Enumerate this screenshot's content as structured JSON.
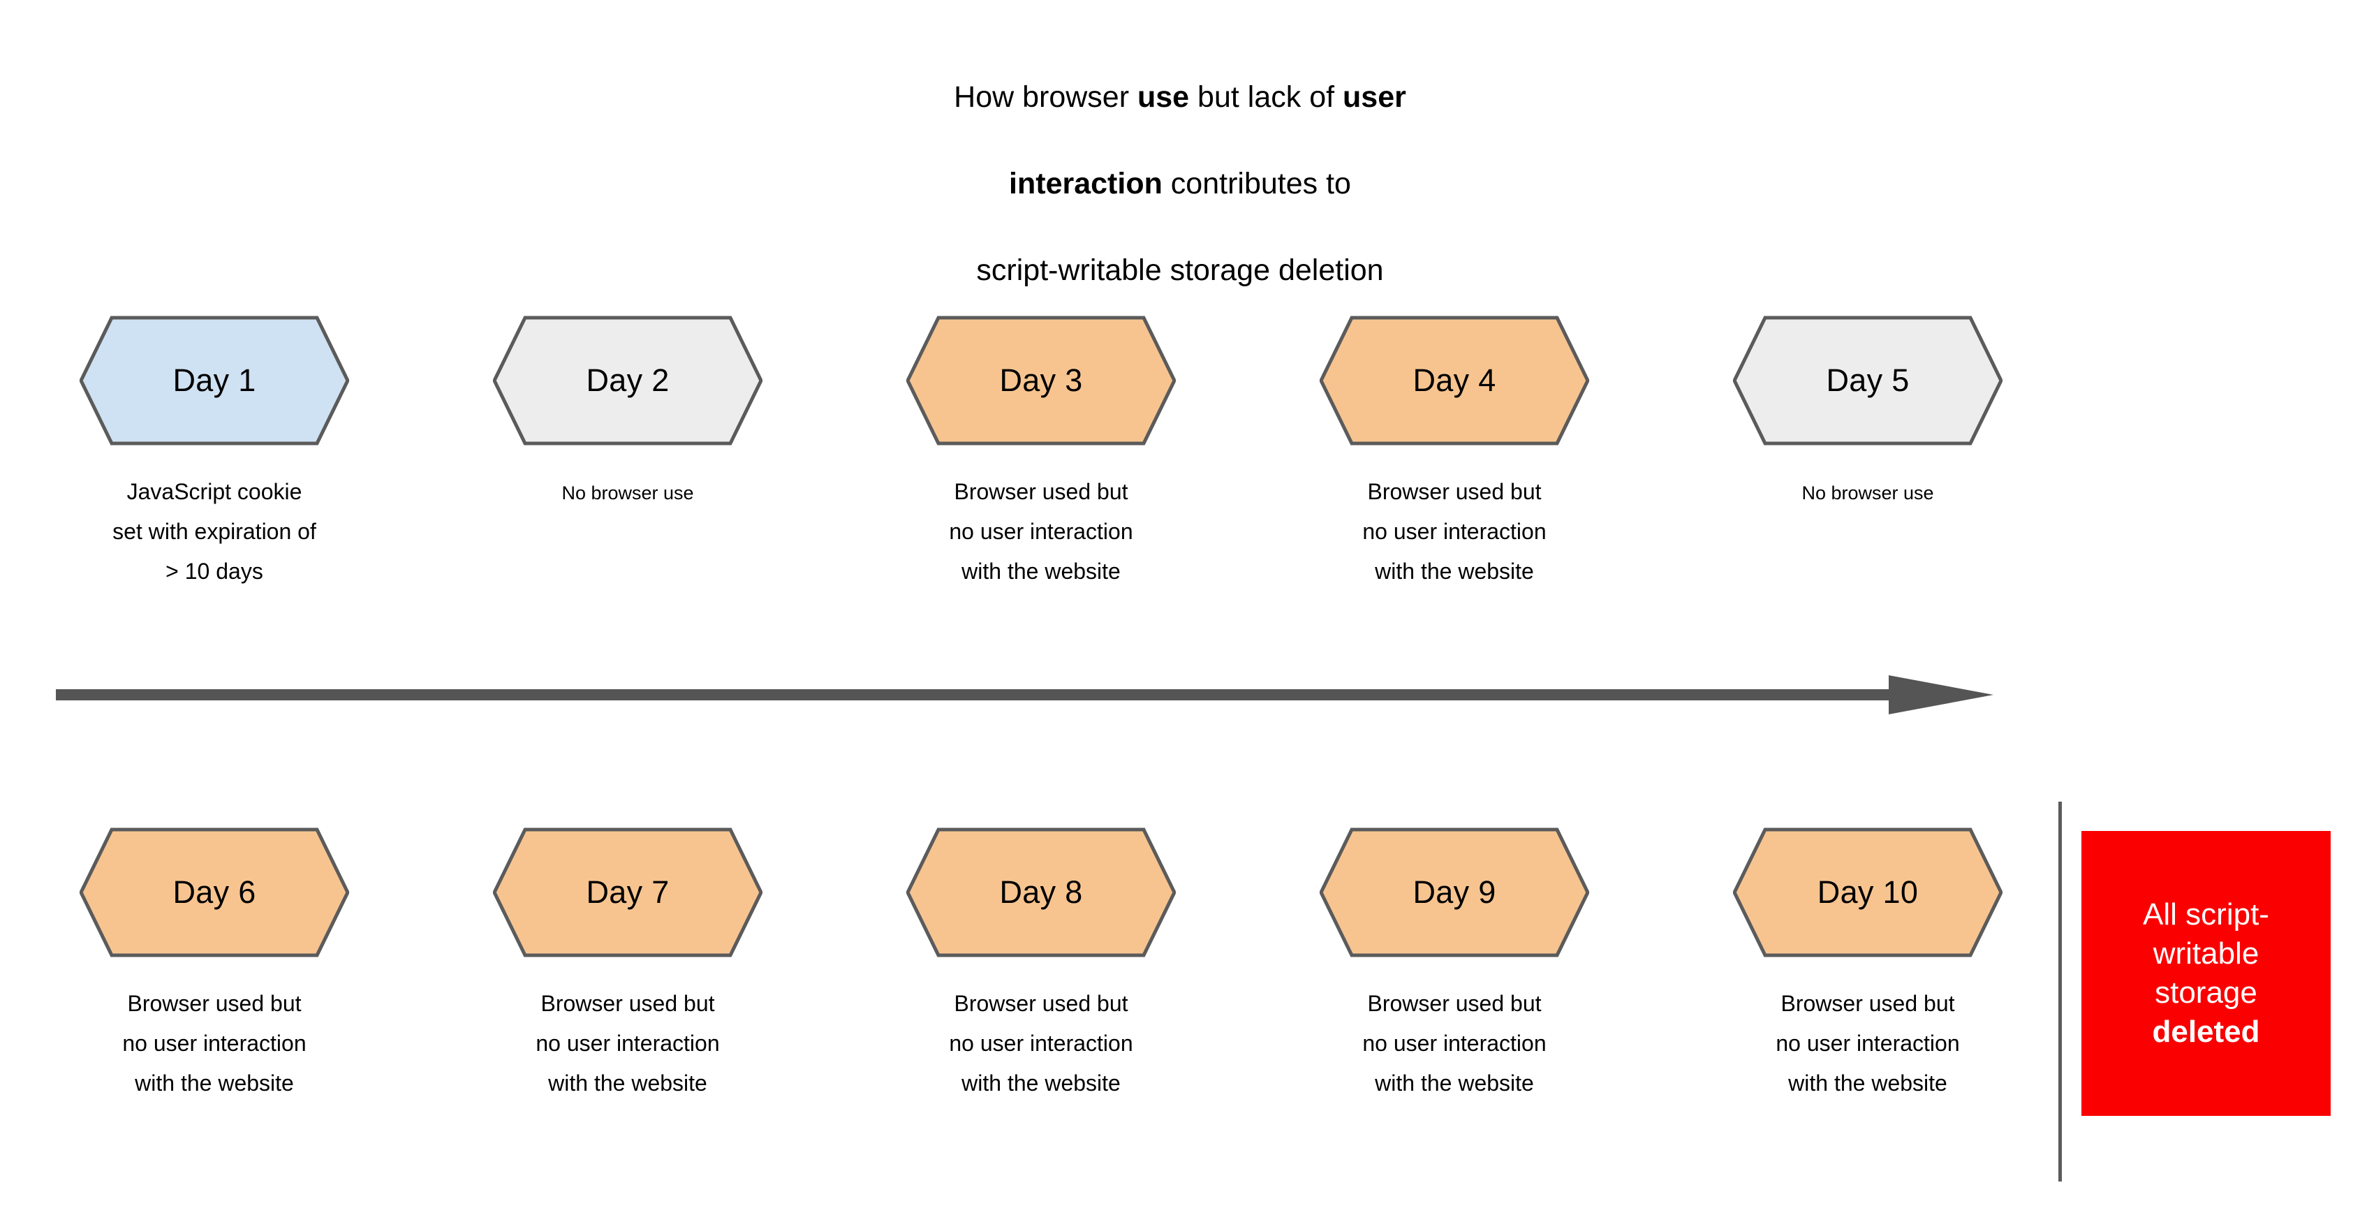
{
  "title": {
    "line1_pre": "How browser ",
    "line1_bold": "use",
    "line1_post": " but lack of ",
    "line1_bold2": "user",
    "line2_bold": "interaction",
    "line2_post": " contributes to",
    "line3": "script-writable storage deletion"
  },
  "colors": {
    "hex_blue": "#cfe2f3",
    "hex_gray": "#ededed",
    "hex_orange": "#f7c490",
    "hex_stroke": "#5b5b5b",
    "arrow": "#555555",
    "callout_red": "#fa0000",
    "divider": "#5b5b5b"
  },
  "top_row": [
    {
      "label": "Day 1",
      "caption": "JavaScript cookie\nset with expiration of\n> 10 days",
      "fill": "#cfe2f3",
      "caption_size": "normal"
    },
    {
      "label": "Day 2",
      "caption": "No browser use",
      "fill": "#ededed",
      "caption_size": "small"
    },
    {
      "label": "Day 3",
      "caption": "Browser used but\nno user interaction\nwith the website",
      "fill": "#f7c490",
      "caption_size": "normal"
    },
    {
      "label": "Day 4",
      "caption": "Browser used but\nno user interaction\nwith the website",
      "fill": "#f7c490",
      "caption_size": "normal"
    },
    {
      "label": "Day 5",
      "caption": "No browser use",
      "fill": "#ededed",
      "caption_size": "small"
    }
  ],
  "bottom_row": [
    {
      "label": "Day 6",
      "caption": "Browser used but\nno user interaction\nwith the website",
      "fill": "#f7c490",
      "caption_size": "normal"
    },
    {
      "label": "Day 7",
      "caption": "Browser used but\nno user interaction\nwith the website",
      "fill": "#f7c490",
      "caption_size": "normal"
    },
    {
      "label": "Day 8",
      "caption": "Browser used but\nno user interaction\nwith the website",
      "fill": "#f7c490",
      "caption_size": "normal"
    },
    {
      "label": "Day 9",
      "caption": "Browser used but\nno user interaction\nwith the website",
      "fill": "#f7c490",
      "caption_size": "normal"
    },
    {
      "label": "Day 10",
      "caption": "Browser used but\nno user interaction\nwith the website",
      "fill": "#f7c490",
      "caption_size": "normal"
    }
  ],
  "timeline": {
    "direction": "left-to-right",
    "icon": "right-arrow-icon"
  },
  "callout": {
    "text_normal": "All script-\nwritable\nstorage",
    "text_bold": "deleted"
  }
}
